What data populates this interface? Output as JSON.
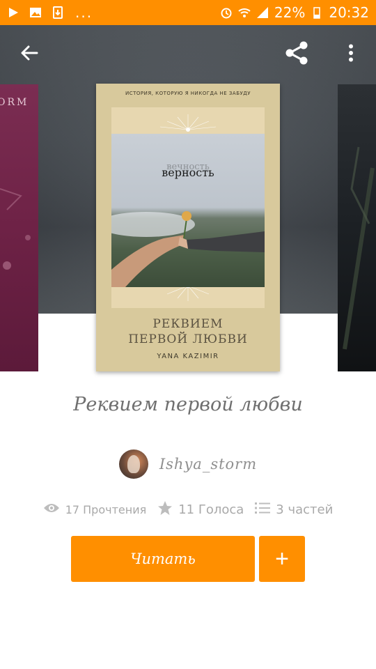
{
  "status_bar": {
    "battery": "22%",
    "time": "20:32",
    "overflow": "..."
  },
  "colors": {
    "accent": "#ff8f00",
    "text_muted": "#a9a9a9"
  },
  "appbar": {
    "icons": [
      "back-arrow-icon",
      "share-icon",
      "more-vert-icon"
    ]
  },
  "cover": {
    "left_peek_text": "ORM",
    "top_caption": "ИСТОРИЯ, КОТОРУЮ Я НИКОГДА НЕ ЗАБУДУ",
    "photo_title": "верность",
    "photo_title_ghost": "вечность",
    "title_line1": "РЕКВИЕМ",
    "title_line2": "ПЕРВОЙ ЛЮБВИ",
    "author": "YANA KAZIMIR"
  },
  "book": {
    "title": "Реквием первой любви",
    "author": "Ishya_storm"
  },
  "stats": {
    "reads": "17 Прочтения",
    "votes": "11 Голоса",
    "parts": "3 частей"
  },
  "actions": {
    "read_label": "Читать",
    "add_label": "+"
  }
}
